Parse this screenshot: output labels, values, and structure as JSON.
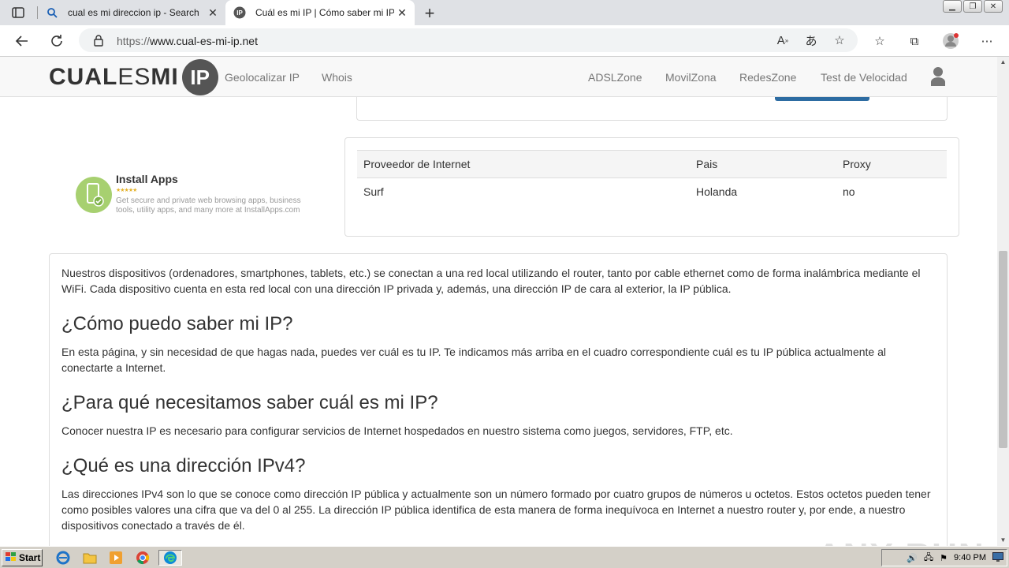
{
  "browser": {
    "tabs": [
      {
        "title": "cual es mi direccion ip - Search",
        "active": false
      },
      {
        "title": "Cuál es mi IP | Cómo saber mi IP",
        "active": true
      }
    ],
    "url_scheme": "https://",
    "url_host": "www.cual-es-mi-ip.net"
  },
  "site": {
    "logo_cual": "CUAL",
    "logo_es": "ES",
    "logo_mi": "MI",
    "logo_ip": "IP",
    "nav_left": [
      "Geolocalizar IP",
      "Whois"
    ],
    "nav_right": [
      "ADSLZone",
      "MovilZona",
      "RedesZone",
      "Test de Velocidad"
    ]
  },
  "ad": {
    "title": "Install Apps",
    "stars": "★★★★★",
    "text": "Get secure and private web browsing apps, business tools, utility apps, and many more at InstallApps.com"
  },
  "info_table": {
    "headers": [
      "Proveedor de Internet",
      "Pais",
      "Proxy"
    ],
    "row": [
      "Surf",
      "Holanda",
      "no"
    ]
  },
  "article": {
    "intro": "Nuestros dispositivos (ordenadores, smartphones, tablets, etc.) se conectan a una red local utilizando el router, tanto por cable ethernet como de forma inalámbrica mediante el WiFi. Cada dispositivo cuenta en esta red local con una dirección IP privada y, además, una dirección IP de cara al exterior, la IP pública.",
    "h1": "¿Cómo puedo saber mi IP?",
    "p1": "En esta página, y sin necesidad de que hagas nada, puedes ver cuál es tu IP. Te indicamos más arriba en el cuadro correspondiente cuál es tu IP pública actualmente al conectarte a Internet.",
    "h2": "¿Para qué necesitamos saber cuál es mi IP?",
    "p2": "Conocer nuestra IP es necesario para configurar servicios de Internet hospedados en nuestro sistema como juegos, servidores, FTP, etc.",
    "h3": "¿Qué es una dirección IPv4?",
    "p3": "Las direcciones IPv4 son lo que se conoce como dirección IP pública y actualmente son un número formado por cuatro grupos de números u octetos. Estos octetos pueden tener como posibles valores una cifra que va del 0 al 255. La dirección IP pública identifica de esta manera de forma inequívoca en Internet a nuestro router y, por ende, a nuestro dispositivos conectado a través de él."
  },
  "watermark": "ANY RUN",
  "taskbar": {
    "start_label": "Start",
    "clock": "9:40 PM"
  }
}
